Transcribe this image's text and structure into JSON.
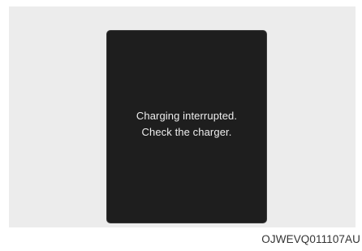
{
  "display": {
    "message_line1": "Charging interrupted.",
    "message_line2": "Check the charger."
  },
  "figure_code": "OJWEVQ011107AU",
  "colors": {
    "panel_background": "#ececec",
    "screen_background": "#1e1e1e",
    "screen_text": "#eeeeee",
    "code_text": "#333333"
  }
}
